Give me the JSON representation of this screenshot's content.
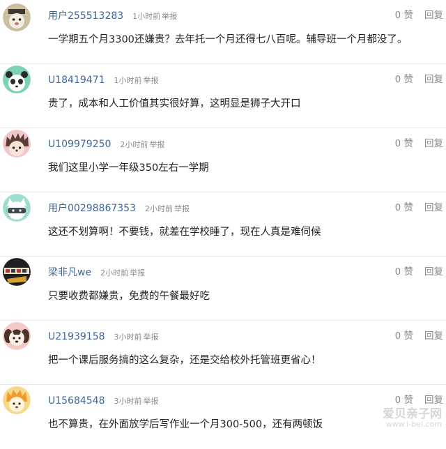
{
  "comments": [
    {
      "username": "用户255513283",
      "time": "1小时前",
      "report": "举报",
      "content": "一学期五个月3300还嫌贵？去年托一个月还得七八百呢。辅导班一个月都没了。",
      "likes": "0 赞",
      "reply": "回复",
      "avatar_icon": "bear-icon"
    },
    {
      "username": "U18419471",
      "time": "1小时前",
      "report": "举报",
      "content": "贵了，成本和人工价值其实很好算，这明显是狮子大开口",
      "likes": "0 赞",
      "reply": "回复",
      "avatar_icon": "panda-icon"
    },
    {
      "username": "U109979250",
      "time": "2小时前",
      "report": "举报",
      "content": "我们这里小学一年级350左右一学期",
      "likes": "0 赞",
      "reply": "回复",
      "avatar_icon": "hedgehog-icon"
    },
    {
      "username": "用户00298867353",
      "time": "2小时前",
      "report": "举报",
      "content": "这还不划算啊！不要钱，就差在学校睡了，现在人真是难伺候",
      "likes": "0 赞",
      "reply": "回复",
      "avatar_icon": "ninja-cat-icon"
    },
    {
      "username": "梁非凡we",
      "time": "2小时前",
      "report": "举报",
      "content": "只要收费都嫌贵，免费的午餐最好吃",
      "likes": "0 赞",
      "reply": "回复",
      "avatar_icon": "photo-avatar-icon"
    },
    {
      "username": "U21939158",
      "time": "3小时前",
      "report": "举报",
      "content": "把一个课后服务搞的这么复杂，还是交给校外托管班更省心！",
      "likes": "0 赞",
      "reply": "回复",
      "avatar_icon": "dog-icon"
    },
    {
      "username": "U15684548",
      "time": "3小时前",
      "report": "举报",
      "content": "也不算贵，在外面放学后写作业一个月300-500，还有两顿饭",
      "likes": "0 赞",
      "reply": "回复",
      "avatar_icon": "lion-icon"
    }
  ],
  "watermark": {
    "text": "爱贝亲子网",
    "url": "www.i-bei.com"
  },
  "colors": {
    "username": "#406599",
    "meta": "#8a8a8a",
    "content": "#222222",
    "divider": "#e8e8e8"
  }
}
